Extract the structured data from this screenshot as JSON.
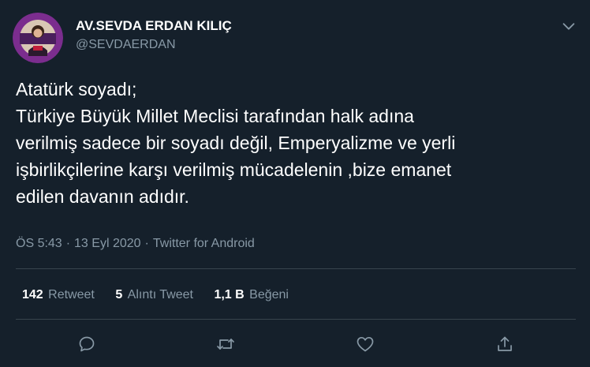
{
  "author": {
    "display_name": "AV.SEVDA ERDAN KILIÇ",
    "handle": "@SEVDAERDAN"
  },
  "tweet": {
    "text": "Atatürk soyadı;\nTürkiye Büyük Millet Meclisi tarafından halk adına\nverilmiş sadece bir soyadı değil, Emperyalizme ve yerli\nişbirlikçilerine karşı verilmiş mücadelenin ,bize emanet\nedilen davanın adıdır."
  },
  "meta": {
    "time": "ÖS 5:43",
    "separator": "·",
    "date": "13 Eyl 2020",
    "source": "Twitter for Android"
  },
  "stats": {
    "retweets_count": "142",
    "retweets_label": "Retweet",
    "quotes_count": "5",
    "quotes_label": "Alıntı Tweet",
    "likes_count": "1,1 B",
    "likes_label": "Beğeni"
  },
  "colors": {
    "background": "#15202b",
    "text": "#ffffff",
    "secondary": "#8899a6",
    "divider": "#38444d",
    "avatar_ring": "#7b2d8e"
  },
  "icons": {
    "menu": "chevron-down-icon",
    "reply": "reply-icon",
    "retweet": "retweet-icon",
    "like": "heart-icon",
    "share": "share-icon"
  }
}
